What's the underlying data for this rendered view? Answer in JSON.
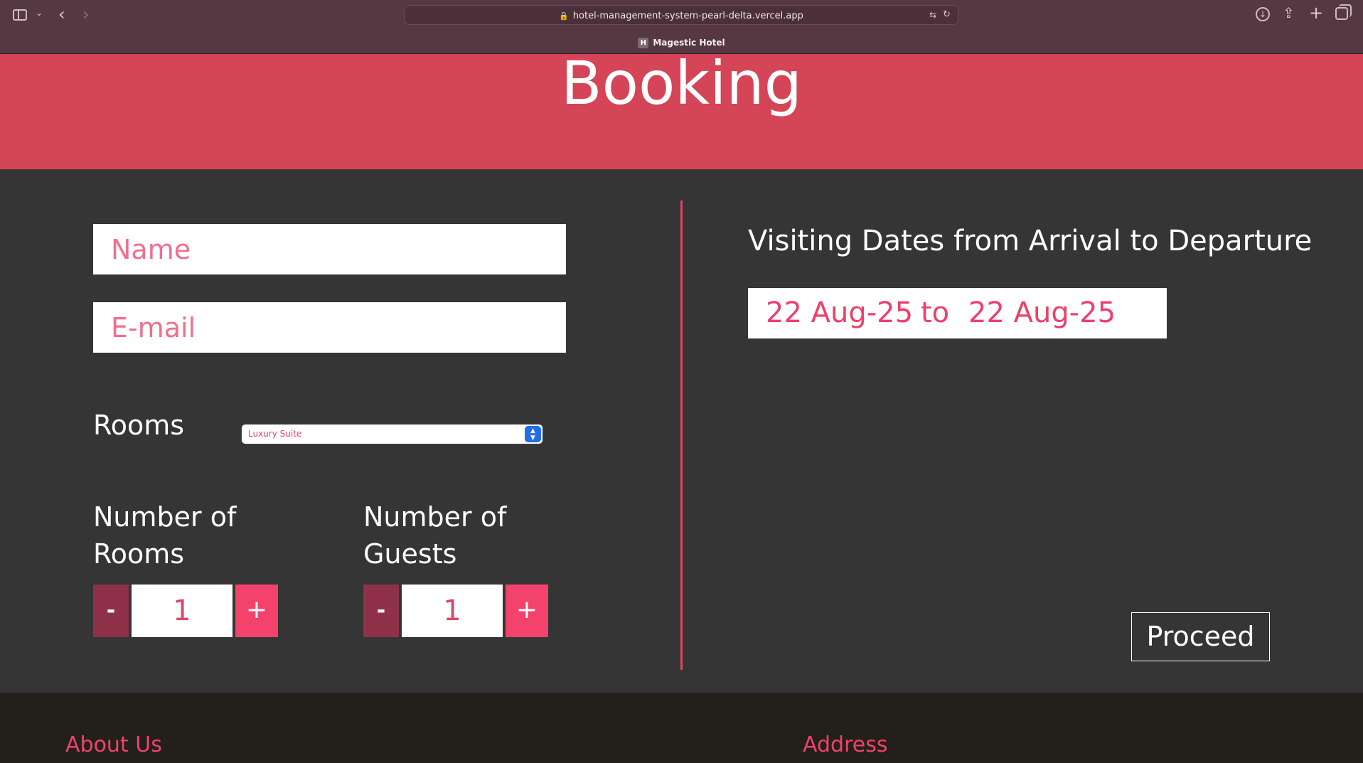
{
  "browser": {
    "url": "hotel-management-system-pearl-delta.vercel.app",
    "tab_title": "Magestic Hotel",
    "favicon_letter": "H"
  },
  "hero": {
    "title": "Booking"
  },
  "form": {
    "name_placeholder": "Name",
    "email_placeholder": "E-mail",
    "rooms_label": "Rooms",
    "rooms_selected": "Luxury Suite",
    "number_of_rooms_label_line1": "Number of",
    "number_of_rooms_label_line2": "Rooms",
    "number_of_guests_label_line1": "Number of",
    "number_of_guests_label_line2": "Guests",
    "minus_label": "-",
    "plus_label": "+",
    "rooms_count": "1",
    "guests_count": "1"
  },
  "dates": {
    "title": "Visiting Dates from Arrival to Departure",
    "from": "22 Aug-25",
    "separator": "to",
    "to": "22 Aug-25"
  },
  "proceed_label": "Proceed",
  "footer": {
    "about_heading": "About Us",
    "address_heading": "Address"
  },
  "colors": {
    "hero": "#d44557",
    "accent": "#f3426c",
    "minus": "#8f3149",
    "background": "#353535",
    "footer": "#23201b"
  }
}
